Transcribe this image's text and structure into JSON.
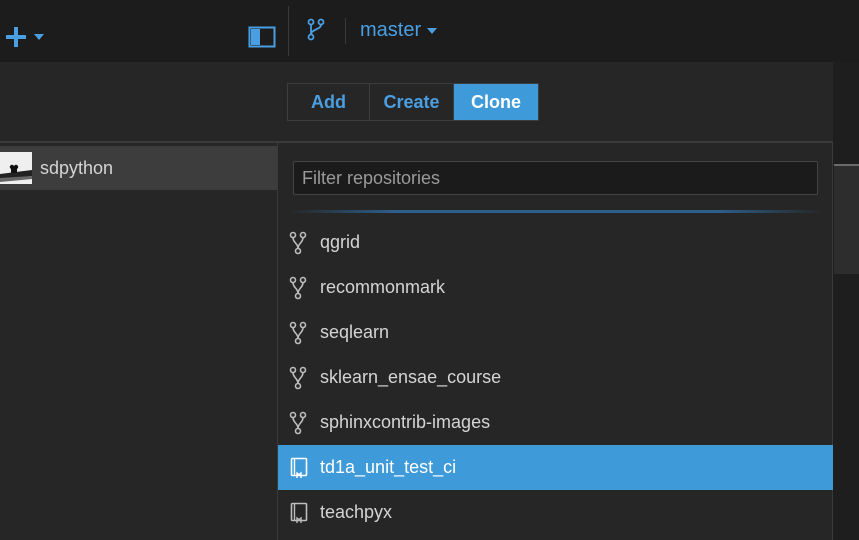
{
  "toolbar": {
    "add_icon": "plus-icon",
    "branch": "master"
  },
  "sidebar": {
    "account": "sdpython"
  },
  "tabs": {
    "add": "Add",
    "create": "Create",
    "clone": "Clone",
    "active": "Clone"
  },
  "filter": {
    "placeholder": "Filter repositories"
  },
  "repos": [
    {
      "name": "qgrid",
      "icon": "fork-icon",
      "selected": false
    },
    {
      "name": "recommonmark",
      "icon": "fork-icon",
      "selected": false
    },
    {
      "name": "seqlearn",
      "icon": "fork-icon",
      "selected": false
    },
    {
      "name": "sklearn_ensae_course",
      "icon": "fork-icon",
      "selected": false
    },
    {
      "name": "sphinxcontrib-images",
      "icon": "fork-icon",
      "selected": false
    },
    {
      "name": "td1a_unit_test_ci",
      "icon": "repo-icon",
      "selected": true
    },
    {
      "name": "teachpyx",
      "icon": "repo-icon",
      "selected": false
    }
  ],
  "colors": {
    "accent": "#3e9ad8",
    "link": "#4a9fe3",
    "background": "#262626"
  }
}
